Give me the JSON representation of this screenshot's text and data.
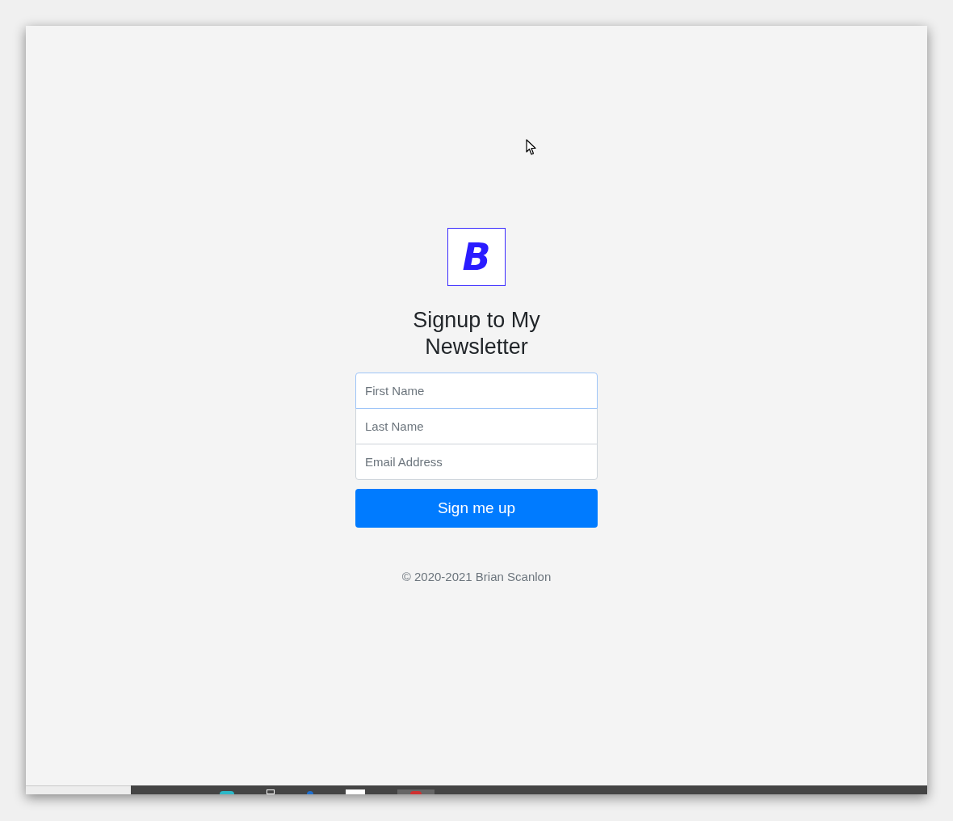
{
  "logo": {
    "letter": "B"
  },
  "heading": "Signup to My Newsletter",
  "fields": [
    {
      "placeholder": "First Name",
      "focused": true
    },
    {
      "placeholder": "Last Name",
      "focused": false
    },
    {
      "placeholder": "Email Address",
      "focused": false
    }
  ],
  "button": "Sign me up",
  "footer": "© 2020-2021 Brian Scanlon"
}
